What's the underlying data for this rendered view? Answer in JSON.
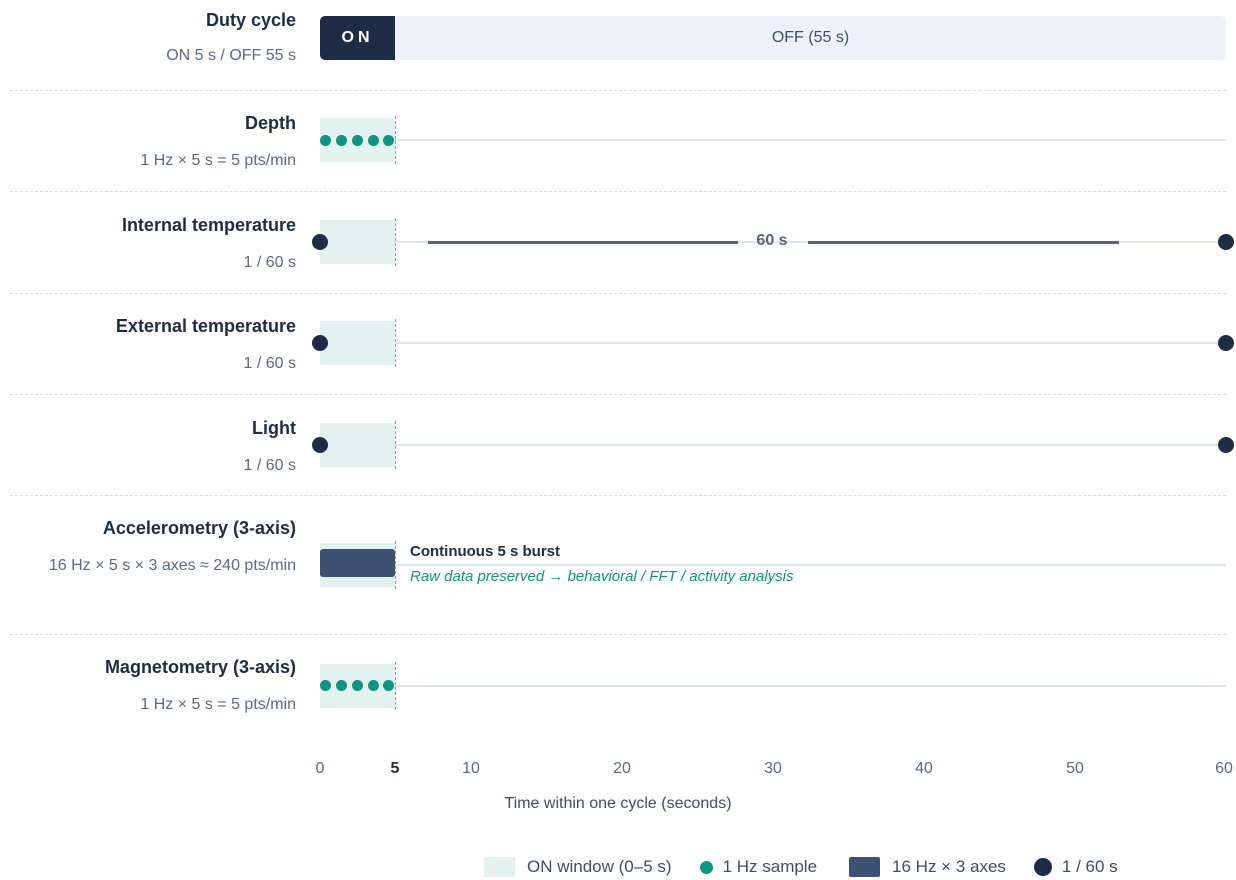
{
  "duty": {
    "title": "Duty cycle",
    "subtitle": "ON 5 s / OFF 55 s",
    "on_label": "ON",
    "off_label": "OFF (55 s)"
  },
  "sensors": [
    {
      "title": "Depth",
      "subtitle": "1 Hz × 5 s = 5 pts/min",
      "sampling": "1 Hz"
    },
    {
      "title": "Internal temperature",
      "subtitle": "1 / 60 s",
      "sampling": "1 / 60 s",
      "interval_label": "60 s"
    },
    {
      "title": "External temperature",
      "subtitle": "1 / 60 s",
      "sampling": "1 / 60 s"
    },
    {
      "title": "Light",
      "subtitle": "1 / 60 s",
      "sampling": "1 / 60 s"
    },
    {
      "title": "Accelerometry (3-axis)",
      "subtitle": "16 Hz × 5 s × 3 axes ≈ 240 pts/min",
      "sampling": "16 Hz × 3 axes",
      "burst_title": "Continuous 5 s burst",
      "burst_note": "Raw data preserved → behavioral / FFT / activity analysis"
    },
    {
      "title": "Magnetometry (3-axis)",
      "subtitle": "1 Hz × 5 s = 5 pts/min",
      "sampling": "1 Hz"
    }
  ],
  "axis": {
    "label": "Time within one cycle (seconds)",
    "ticks": [
      "0",
      "5",
      "10",
      "20",
      "30",
      "40",
      "50",
      "60"
    ],
    "highlight_tick": "5"
  },
  "legend": {
    "on_window": "ON window (0–5 s)",
    "hz1": "1 Hz sample",
    "hz16": "16 Hz × 3 axes",
    "per60": "1 / 60 s"
  },
  "colors": {
    "navy": "#1e2d45",
    "teal": "#0e9583",
    "on_window": "#e4f2ef",
    "off_bar": "#eef2f8",
    "burst": "#3d5272"
  }
}
